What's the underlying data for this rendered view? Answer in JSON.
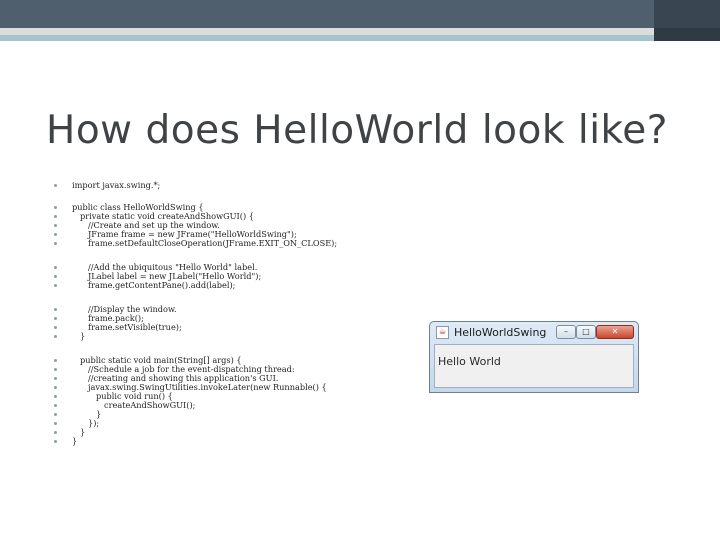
{
  "header": {
    "colors": {
      "bar": "#4f5f6e",
      "bar_dark": "#3a4552",
      "stripe": "#dcdcdc",
      "accent": "#a5c6c8"
    }
  },
  "slide": {
    "title": "How does HelloWorld look like?"
  },
  "code_lines": [
    "import javax.swing.*;",
    "public class HelloWorldSwing {",
    "private static void createAndShowGUI() {",
    "//Create and set up the window.",
    "JFrame frame = new JFrame(\"HelloWorldSwing\");",
    "frame.setDefaultCloseOperation(JFrame.EXIT_ON_CLOSE);",
    "//Add the ubiquitous \"Hello World\" label.",
    "JLabel label = new JLabel(\"Hello World\");",
    "frame.getContentPane().add(label);",
    "//Display the window.",
    "frame.pack();",
    "frame.setVisible(true);",
    "}",
    "public static void main(String[] args) {",
    "//Schedule a job for the event-dispatching thread:",
    "//creating and showing this application's GUI.",
    "javax.swing.SwingUtilities.invokeLater(new Runnable() {",
    "public void run() {",
    "createAndShowGUI();",
    "}",
    "});",
    "}",
    "}"
  ],
  "window": {
    "title": "HelloWorldSwing",
    "label": "Hello World",
    "icon": "java-icon",
    "minimize_glyph": "–",
    "maximize_glyph": "□",
    "close_glyph": "✕"
  }
}
